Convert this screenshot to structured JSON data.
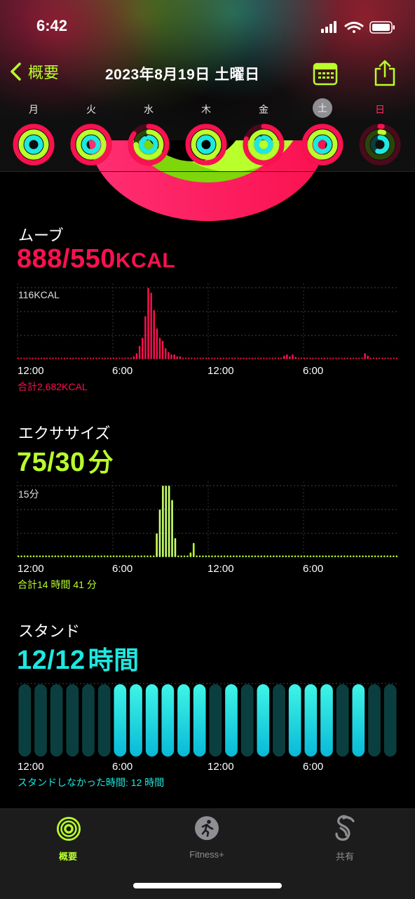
{
  "status_bar": {
    "time": "6:42"
  },
  "nav": {
    "back_label": "概要",
    "date": "2023年8月19日 土曜日"
  },
  "week": {
    "days": [
      "月",
      "火",
      "水",
      "木",
      "金",
      "土",
      "日"
    ],
    "selected_index": 5,
    "rings": [
      {
        "move": 1.0,
        "exercise": 1.0,
        "stand": 1.0
      },
      {
        "move": 1.0,
        "exercise": 1.0,
        "stand": 1.0
      },
      {
        "move": 0.85,
        "exercise": 0.75,
        "stand": 0.9
      },
      {
        "move": 1.0,
        "exercise": 1.0,
        "stand": 1.0
      },
      {
        "move": 0.8,
        "exercise": 1.0,
        "stand": 0.9
      },
      {
        "move": 1.0,
        "exercise": 1.0,
        "stand": 1.0
      },
      {
        "move": 0.02,
        "exercise": 0.05,
        "stand": 0.55
      }
    ]
  },
  "colors": {
    "move": "#fa114f",
    "exercise": "#b9ff2b",
    "stand": "#1ee8e0",
    "accent": "#b9ff2b"
  },
  "move": {
    "title": "ムーブ",
    "value": "888/550",
    "unit": "KCAL",
    "max_label": "116KCAL",
    "total": "合計2,682KCAL"
  },
  "exercise": {
    "title": "エクササイズ",
    "value": "75/30",
    "unit": "分",
    "max_label": "15分",
    "total": "合計14 時間 41 分"
  },
  "stand": {
    "title": "スタンド",
    "value": "12/12",
    "unit": "時間",
    "total": "スタンドしなかった時間: 12 時間"
  },
  "time_axis": [
    "12:00",
    "6:00",
    "12:00",
    "6:00"
  ],
  "chart_data": [
    {
      "type": "bar",
      "title": "ムーブ",
      "ylim": [
        0,
        116
      ],
      "values": [
        2,
        2,
        2,
        2,
        2,
        2,
        2,
        2,
        2,
        2,
        2,
        2,
        2,
        2,
        2,
        2,
        2,
        2,
        2,
        2,
        2,
        2,
        2,
        2,
        2,
        2,
        2,
        2,
        2,
        2,
        2,
        2,
        2,
        2,
        3,
        2,
        2,
        3,
        3,
        3,
        5,
        10,
        22,
        35,
        70,
        116,
        108,
        80,
        50,
        35,
        30,
        18,
        12,
        8,
        8,
        5,
        5,
        3,
        3,
        3,
        2,
        2,
        2,
        2,
        2,
        2,
        2,
        2,
        2,
        2,
        2,
        2,
        2,
        2,
        2,
        2,
        2,
        2,
        2,
        2,
        2,
        2,
        2,
        2,
        2,
        2,
        2,
        2,
        2,
        2,
        3,
        3,
        6,
        8,
        5,
        8,
        4,
        2,
        2,
        2,
        2,
        2,
        2,
        2,
        2,
        2,
        2,
        2,
        2,
        2,
        2,
        2,
        2,
        2,
        2,
        2,
        2,
        2,
        2,
        3,
        10,
        6,
        2,
        2,
        2,
        2,
        2,
        2,
        2,
        2,
        2,
        2
      ]
    },
    {
      "type": "bar",
      "title": "エクササイズ",
      "ylim": [
        0,
        15
      ],
      "values": [
        0,
        0,
        0,
        0,
        0,
        0,
        0,
        0,
        0,
        0,
        0,
        0,
        0,
        0,
        0,
        0,
        0,
        0,
        0,
        0,
        0,
        0,
        0,
        0,
        0,
        0,
        0,
        0,
        0,
        0,
        0,
        0,
        0,
        0,
        0,
        0,
        0,
        0,
        0,
        0,
        0,
        0,
        0,
        0,
        0,
        5,
        10,
        15,
        15,
        15,
        12,
        4,
        0,
        0,
        0,
        0,
        1,
        3,
        0,
        0,
        0,
        0,
        0,
        0,
        0,
        0,
        0,
        0,
        0,
        0,
        0,
        0,
        0,
        0,
        0,
        0,
        0,
        0,
        0,
        0,
        0,
        0,
        0,
        0,
        0,
        0,
        0,
        0,
        0,
        0,
        0,
        0,
        0,
        0,
        0,
        0,
        0,
        0,
        0,
        0,
        0,
        0,
        0,
        0,
        0,
        0,
        0,
        0,
        0,
        0,
        0,
        0,
        0,
        0,
        0,
        0,
        0,
        0,
        0,
        0,
        0,
        0,
        0,
        0
      ]
    },
    {
      "type": "bar",
      "title": "スタンド",
      "values": [
        0,
        0,
        0,
        0,
        0,
        0,
        1,
        1,
        1,
        1,
        1,
        1,
        0,
        1,
        0,
        1,
        0,
        1,
        1,
        1,
        0,
        1,
        0,
        0
      ],
      "legend": "1 = stood that hour"
    }
  ],
  "tabs": [
    {
      "label": "概要",
      "icon": "activity-rings-icon",
      "active": true
    },
    {
      "label": "Fitness+",
      "icon": "fitness-plus-icon",
      "active": false
    },
    {
      "label": "共有",
      "icon": "sharing-icon",
      "active": false
    }
  ]
}
